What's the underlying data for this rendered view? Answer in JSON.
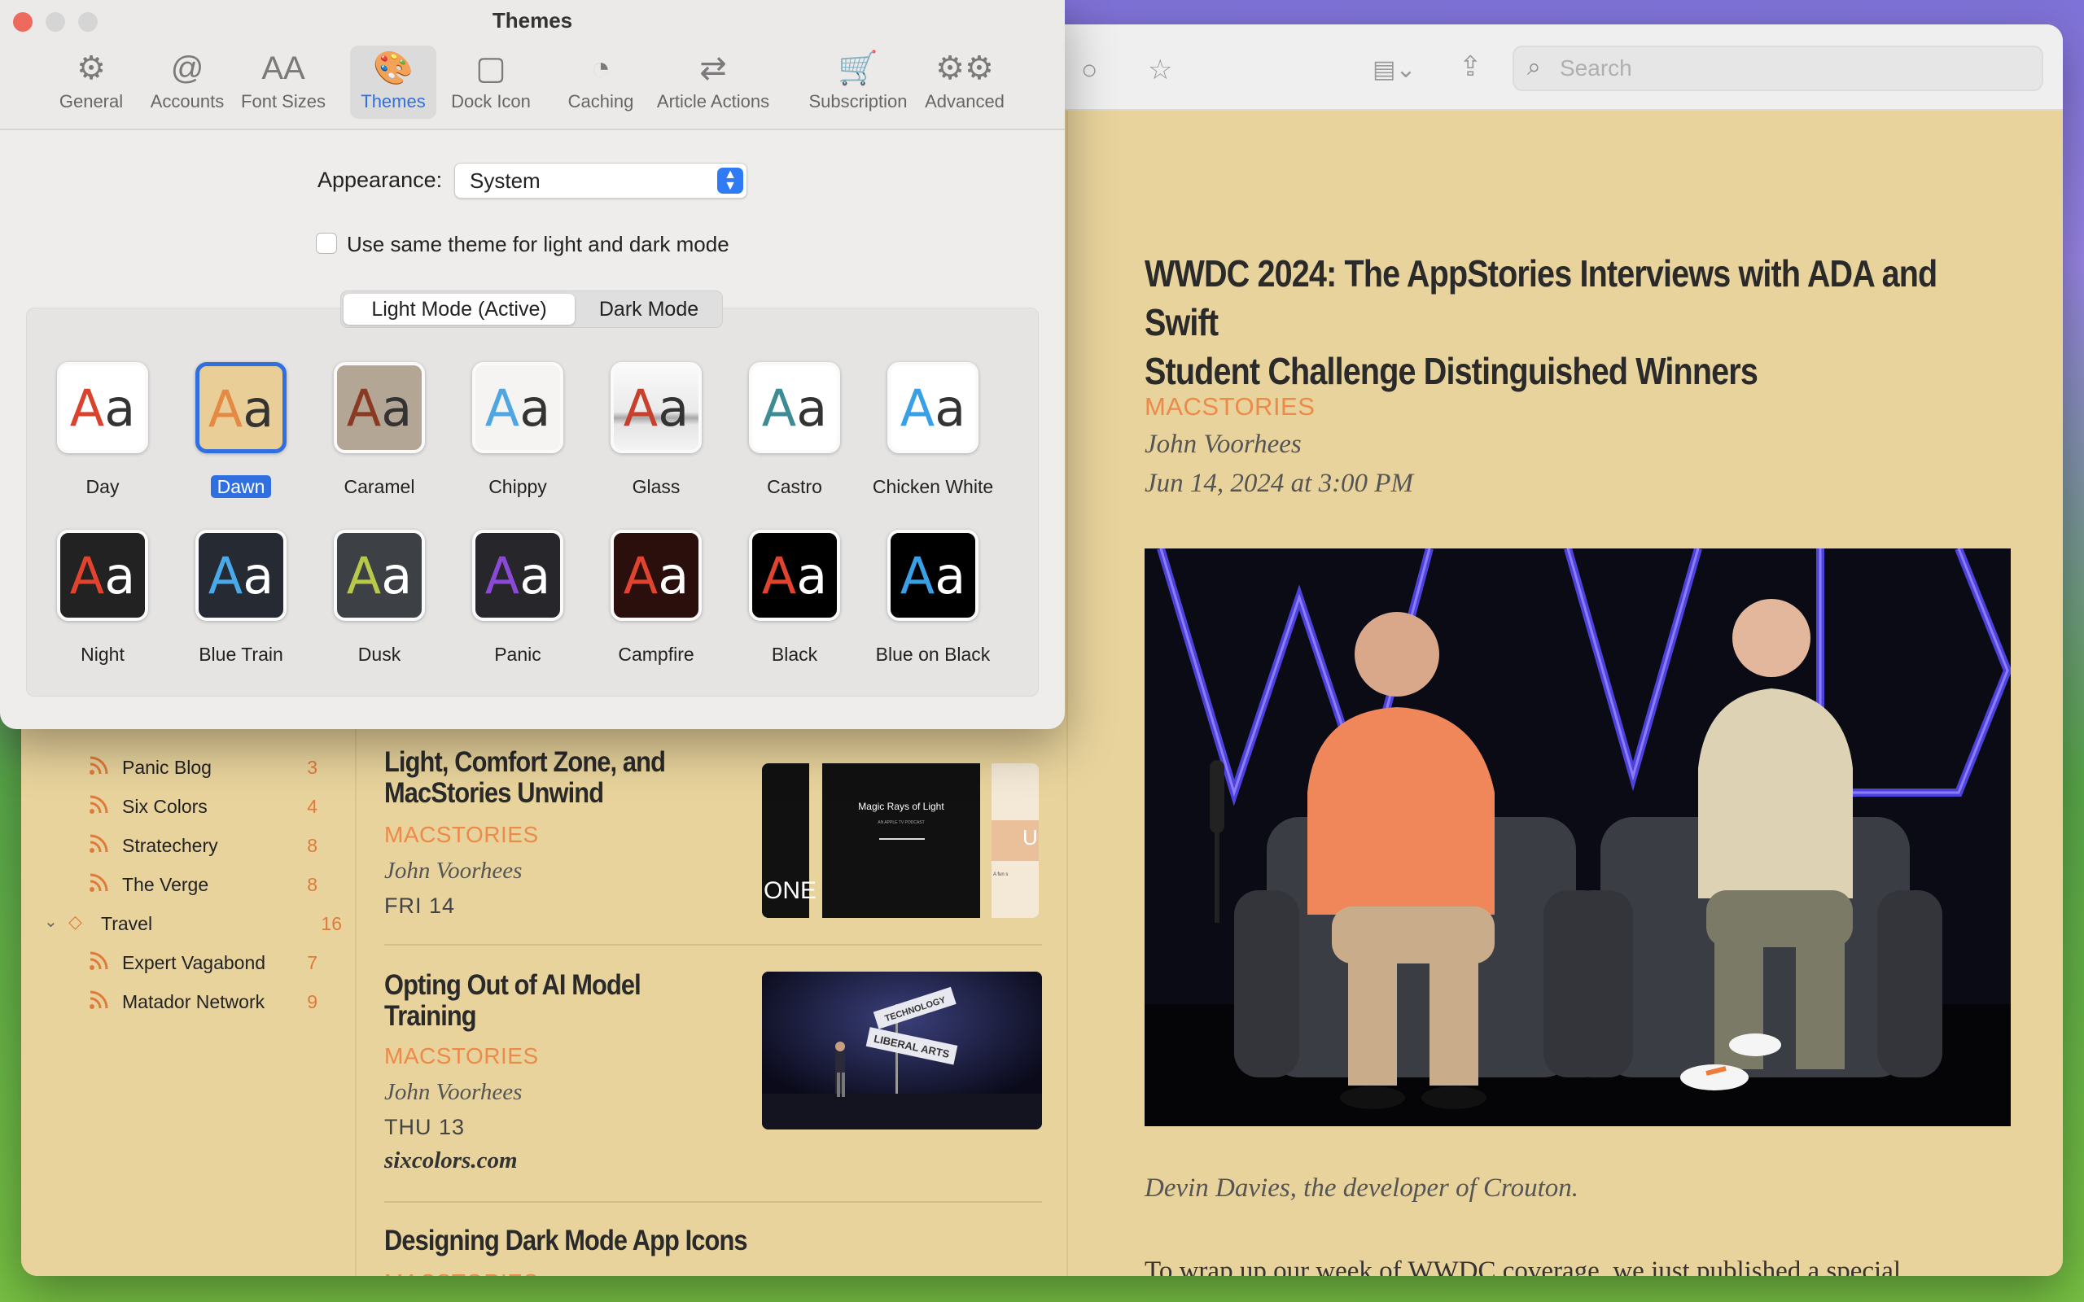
{
  "themes_window": {
    "title": "Themes",
    "tabs": [
      {
        "label": "General",
        "icon": "gear-icon",
        "glyph": "⚙"
      },
      {
        "label": "Accounts",
        "icon": "at-icon",
        "glyph": "@"
      },
      {
        "label": "Font Sizes",
        "icon": "font-size-icon",
        "glyph": "AA"
      },
      {
        "label": "Themes",
        "icon": "palette-icon",
        "glyph": "🎨"
      },
      {
        "label": "Dock Icon",
        "icon": "dock-icon",
        "glyph": "▢"
      },
      {
        "label": "Caching",
        "icon": "gauge-icon",
        "glyph": "◔"
      },
      {
        "label": "Article Actions",
        "icon": "actions-icon",
        "glyph": "⇄"
      },
      {
        "label": "Subscription",
        "icon": "cart-icon",
        "glyph": "🛒"
      },
      {
        "label": "Advanced",
        "icon": "gears-icon",
        "glyph": "⚙⚙"
      }
    ],
    "appearance_label": "Appearance:",
    "appearance_value": "System",
    "same_theme_label": "Use same theme for light and dark mode",
    "mode_segments": [
      "Light Mode (Active)",
      "Dark Mode"
    ],
    "light_themes": [
      {
        "name": "Day",
        "bg": "#ffffff",
        "a": "#d9432e",
        "b": "#333333"
      },
      {
        "name": "Dawn",
        "bg": "#e9cf97",
        "a": "#e58a45",
        "b": "#333333"
      },
      {
        "name": "Caramel",
        "bg": "#b3a694",
        "a": "#8a3a22",
        "b": "#333333"
      },
      {
        "name": "Chippy",
        "bg": "#f5f4f3",
        "a": "#4fa6e0",
        "b": "#333333"
      },
      {
        "name": "Glass",
        "bg": "#f3f3f3",
        "a": "#c7402d",
        "b": "#333333"
      },
      {
        "name": "Castro",
        "bg": "#ffffff",
        "a": "#3e8b94",
        "b": "#333333"
      },
      {
        "name": "Chicken White",
        "bg": "#ffffff",
        "a": "#3aa0e6",
        "b": "#333333"
      }
    ],
    "dark_themes": [
      {
        "name": "Night",
        "bg": "#222222",
        "a": "#e0442e",
        "b": "#ffffff"
      },
      {
        "name": "Blue Train",
        "bg": "#252a33",
        "a": "#4aa9e8",
        "b": "#ffffff"
      },
      {
        "name": "Dusk",
        "bg": "#3d4045",
        "a": "#b8c84a",
        "b": "#ffffff"
      },
      {
        "name": "Panic",
        "bg": "#27262b",
        "a": "#8a4ad6",
        "b": "#ffffff"
      },
      {
        "name": "Campfire",
        "bg": "#2a0f0c",
        "a": "#e0442e",
        "b": "#ffffff"
      },
      {
        "name": "Black",
        "bg": "#000000",
        "a": "#e0442e",
        "b": "#ffffff"
      },
      {
        "name": "Blue on Black",
        "bg": "#000000",
        "a": "#3aa0e6",
        "b": "#ffffff"
      }
    ],
    "selected_theme": "Dawn"
  },
  "reader": {
    "search_placeholder": "Search",
    "sidebar": [
      {
        "label": "Panic Blog",
        "count": "3",
        "indent": true
      },
      {
        "label": "Six Colors",
        "count": "4",
        "indent": true
      },
      {
        "label": "Stratechery",
        "count": "8",
        "indent": true
      },
      {
        "label": "The Verge",
        "count": "8",
        "indent": true
      },
      {
        "label": "Travel",
        "count": "16",
        "indent": false
      },
      {
        "label": "Expert Vagabond",
        "count": "7",
        "indent": true
      },
      {
        "label": "Matador Network",
        "count": "9",
        "indent": true
      }
    ],
    "articles": [
      {
        "title_lines": [
          "Light, Comfort Zone, and",
          "MacStories Unwind"
        ],
        "source": "MACSTORIES",
        "author": "John Voorhees",
        "date": "FRI 14",
        "domain": ""
      },
      {
        "title_lines": [
          "Opting Out of AI Model",
          "Training"
        ],
        "source": "MACSTORIES",
        "author": "John Voorhees",
        "date": "THU 13",
        "domain": "sixcolors.com"
      },
      {
        "title_lines": [
          "Designing Dark Mode App Icons"
        ],
        "source": "MACSTORIES",
        "author": "",
        "date": "",
        "domain": ""
      }
    ],
    "thumb_texts": {
      "one": "ONE",
      "magic_title": "Magic Rays of Light",
      "magic_sub": "AN APPLE TV PODCAST",
      "u": "U",
      "afun": "A fun s"
    },
    "street_signs": [
      "TECHNOLOGY",
      "LIBERAL ARTS"
    ],
    "article": {
      "title_lines": [
        "WWDC 2024: The AppStories Interviews with ADA and Swift",
        "Student Challenge Distinguished Winners"
      ],
      "source": "MACSTORIES",
      "author": "John Voorhees",
      "date": "Jun 14, 2024 at 3:00 PM",
      "caption": "Devin Davies, the developer of Crouton.",
      "body": "To wrap up our week of WWDC coverage, we just published a special"
    }
  }
}
